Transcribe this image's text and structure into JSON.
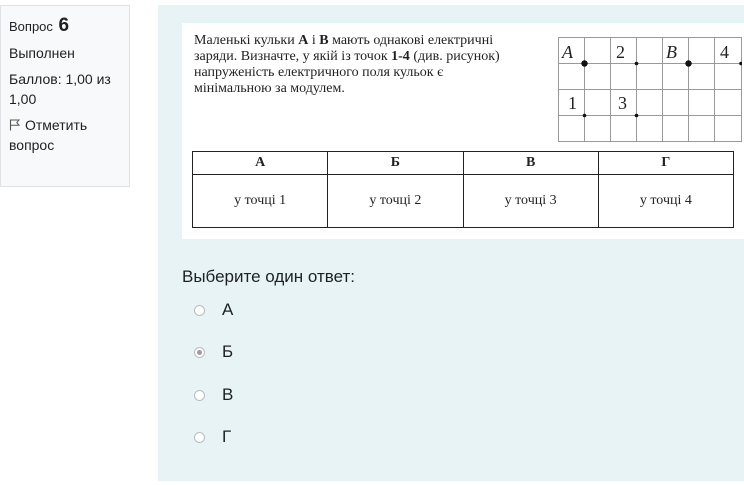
{
  "info": {
    "question_label": "Вопрос",
    "question_number": "6",
    "status": "Выполнен",
    "score": "Баллов: 1,00 из 1,00",
    "flag_label": "Отметить вопрос"
  },
  "question": {
    "text_parts": [
      "Маленькі кульки ",
      "A",
      " і ",
      "B",
      " мають однакові електричні заряди. Визначте, у якій із точок ",
      "1-4",
      " (див. рисунок) напруженість електричного поля кульок є мінімальною за модулем."
    ],
    "grid_labels": {
      "A": "A",
      "two": "2",
      "B": "B",
      "four": "4",
      "one": "1",
      "three": "3"
    },
    "table": {
      "headers": [
        "А",
        "Б",
        "В",
        "Г"
      ],
      "cells": [
        "у точці 1",
        "у точці 2",
        "у точці 3",
        "у точці 4"
      ]
    }
  },
  "answer": {
    "prompt": "Выберите один ответ:",
    "options": [
      "А",
      "Б",
      "В",
      "Г"
    ],
    "selected_index": 1
  }
}
